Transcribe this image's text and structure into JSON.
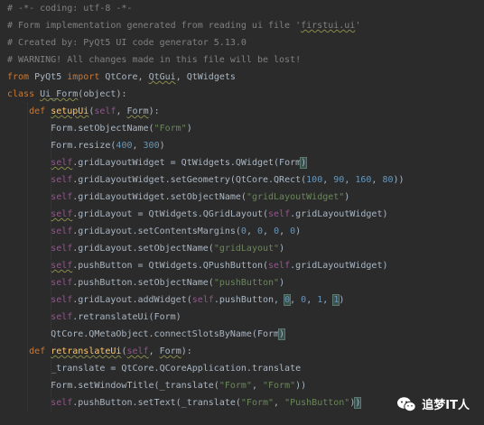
{
  "editor": {
    "language": "python",
    "lines": [
      [
        {
          "t": "# -*- coding: utf-8 -*-",
          "c": "cm"
        }
      ],
      [
        {
          "t": "# Form implementation generated from reading ui file '",
          "c": "cm"
        },
        {
          "t": "firstui.ui",
          "c": "cm wavy"
        },
        {
          "t": "'",
          "c": "cm"
        }
      ],
      [
        {
          "t": "# Created by: PyQt5 UI code generator 5.13.0",
          "c": "cm"
        }
      ],
      [
        {
          "t": "# WARNING! All changes made in this file will be lost!",
          "c": "cm"
        }
      ],
      [
        {
          "t": "from ",
          "c": "kw"
        },
        {
          "t": "PyQt5 ",
          "c": "cls"
        },
        {
          "t": "import ",
          "c": "kw"
        },
        {
          "t": "QtCore, ",
          "c": "cls"
        },
        {
          "t": "QtGui",
          "c": "cls wavy"
        },
        {
          "t": ", QtWidgets",
          "c": "cls"
        }
      ],
      [
        {
          "t": "class ",
          "c": "kw"
        },
        {
          "t": "Ui_Form",
          "c": "cls wavy"
        },
        {
          "t": "(",
          "c": "cls"
        },
        {
          "t": "object",
          "c": "cls"
        },
        {
          "t": "):",
          "c": "cls"
        }
      ],
      [
        {
          "t": "    ",
          "c": "cls"
        },
        {
          "t": "def ",
          "c": "kw"
        },
        {
          "t": "setupUi",
          "c": "fn wavy"
        },
        {
          "t": "(",
          "c": "cls"
        },
        {
          "t": "self",
          "c": "slf"
        },
        {
          "t": ", ",
          "c": "cls"
        },
        {
          "t": "Form",
          "c": "cls wavy"
        },
        {
          "t": "):",
          "c": "cls"
        }
      ],
      [
        {
          "t": "        Form.setObjectName(",
          "c": "cls"
        },
        {
          "t": "\"Form\"",
          "c": "str"
        },
        {
          "t": ")",
          "c": "cls"
        }
      ],
      [
        {
          "t": "        Form.resize(",
          "c": "cls"
        },
        {
          "t": "400",
          "c": "num"
        },
        {
          "t": ", ",
          "c": "cls"
        },
        {
          "t": "300",
          "c": "num"
        },
        {
          "t": ")",
          "c": "cls"
        }
      ],
      [
        {
          "t": "        ",
          "c": "cls"
        },
        {
          "t": "self",
          "c": "slf wavy"
        },
        {
          "t": ".gridLayoutWidget = QtWidgets.QWidget(Form",
          "c": "cls"
        },
        {
          "t": ")",
          "c": "cls hl"
        }
      ],
      [
        {
          "t": "        ",
          "c": "cls"
        },
        {
          "t": "self",
          "c": "slf"
        },
        {
          "t": ".gridLayoutWidget.setGeometry(QtCore.QRect(",
          "c": "cls"
        },
        {
          "t": "100",
          "c": "num"
        },
        {
          "t": ", ",
          "c": "cls"
        },
        {
          "t": "90",
          "c": "num"
        },
        {
          "t": ", ",
          "c": "cls"
        },
        {
          "t": "160",
          "c": "num"
        },
        {
          "t": ", ",
          "c": "cls"
        },
        {
          "t": "80",
          "c": "num"
        },
        {
          "t": "))",
          "c": "cls"
        }
      ],
      [
        {
          "t": "        ",
          "c": "cls"
        },
        {
          "t": "self",
          "c": "slf"
        },
        {
          "t": ".gridLayoutWidget.setObjectName(",
          "c": "cls"
        },
        {
          "t": "\"gridLayoutWidget\"",
          "c": "str"
        },
        {
          "t": ")",
          "c": "cls"
        }
      ],
      [
        {
          "t": "        ",
          "c": "cls"
        },
        {
          "t": "self",
          "c": "slf wavy"
        },
        {
          "t": ".gridLayout = QtWidgets.QGridLayout(",
          "c": "cls"
        },
        {
          "t": "self",
          "c": "slf"
        },
        {
          "t": ".gridLayoutWidget)",
          "c": "cls"
        }
      ],
      [
        {
          "t": "        ",
          "c": "cls"
        },
        {
          "t": "self",
          "c": "slf"
        },
        {
          "t": ".gridLayout.setContentsMargins(",
          "c": "cls"
        },
        {
          "t": "0",
          "c": "num"
        },
        {
          "t": ", ",
          "c": "cls"
        },
        {
          "t": "0",
          "c": "num"
        },
        {
          "t": ", ",
          "c": "cls"
        },
        {
          "t": "0",
          "c": "num"
        },
        {
          "t": ", ",
          "c": "cls"
        },
        {
          "t": "0",
          "c": "num"
        },
        {
          "t": ")",
          "c": "cls"
        }
      ],
      [
        {
          "t": "        ",
          "c": "cls"
        },
        {
          "t": "self",
          "c": "slf"
        },
        {
          "t": ".gridLayout.setObjectName(",
          "c": "cls"
        },
        {
          "t": "\"gridLayout\"",
          "c": "str"
        },
        {
          "t": ")",
          "c": "cls"
        }
      ],
      [
        {
          "t": "        ",
          "c": "cls"
        },
        {
          "t": "self",
          "c": "slf wavy"
        },
        {
          "t": ".pushButton = QtWidgets.QPushButton(",
          "c": "cls"
        },
        {
          "t": "self",
          "c": "slf"
        },
        {
          "t": ".gridLayoutWidget)",
          "c": "cls"
        }
      ],
      [
        {
          "t": "        ",
          "c": "cls"
        },
        {
          "t": "self",
          "c": "slf"
        },
        {
          "t": ".pushButton.setObjectName(",
          "c": "cls"
        },
        {
          "t": "\"pushButton\"",
          "c": "str"
        },
        {
          "t": ")",
          "c": "cls"
        }
      ],
      [
        {
          "t": "        ",
          "c": "cls"
        },
        {
          "t": "self",
          "c": "slf"
        },
        {
          "t": ".gridLayout.addWidget(",
          "c": "cls"
        },
        {
          "t": "self",
          "c": "slf"
        },
        {
          "t": ".pushButton, ",
          "c": "cls"
        },
        {
          "t": "0",
          "c": "num hl"
        },
        {
          "t": ", ",
          "c": "cls"
        },
        {
          "t": "0",
          "c": "num"
        },
        {
          "t": ", ",
          "c": "cls"
        },
        {
          "t": "1",
          "c": "num"
        },
        {
          "t": ", ",
          "c": "cls"
        },
        {
          "t": "1",
          "c": "num hl"
        },
        {
          "t": ")",
          "c": "cls"
        }
      ],
      [
        {
          "t": "        ",
          "c": "cls"
        },
        {
          "t": "self",
          "c": "slf"
        },
        {
          "t": ".retranslateUi(Form)",
          "c": "cls"
        }
      ],
      [
        {
          "t": "        QtCore.QMetaObject.connectSlotsByName(Form",
          "c": "cls"
        },
        {
          "t": ")",
          "c": "cls hl"
        }
      ],
      [
        {
          "t": "    ",
          "c": "cls"
        },
        {
          "t": "def ",
          "c": "kw"
        },
        {
          "t": "retranslateUi",
          "c": "fn wavy"
        },
        {
          "t": "(",
          "c": "cls"
        },
        {
          "t": "self",
          "c": "slf wavy"
        },
        {
          "t": ", ",
          "c": "cls"
        },
        {
          "t": "Form",
          "c": "cls wavy"
        },
        {
          "t": "):",
          "c": "cls"
        }
      ],
      [
        {
          "t": "        _translate = QtCore.QCoreApplication.translate",
          "c": "cls"
        }
      ],
      [
        {
          "t": "        Form.setWindowTitle(_translate(",
          "c": "cls"
        },
        {
          "t": "\"Form\"",
          "c": "str"
        },
        {
          "t": ", ",
          "c": "cls"
        },
        {
          "t": "\"Form\"",
          "c": "str"
        },
        {
          "t": "))",
          "c": "cls"
        }
      ],
      [
        {
          "t": "        ",
          "c": "cls"
        },
        {
          "t": "self",
          "c": "slf"
        },
        {
          "t": ".pushButton.setText(_translate(",
          "c": "cls"
        },
        {
          "t": "\"Form\"",
          "c": "str"
        },
        {
          "t": ", ",
          "c": "cls"
        },
        {
          "t": "\"PushButton\"",
          "c": "str"
        },
        {
          "t": ")",
          "c": "cls"
        },
        {
          "t": ")",
          "c": "cls hl"
        }
      ]
    ]
  },
  "watermark": {
    "text": "追梦IT人",
    "icon": "wechat-icon"
  },
  "colors": {
    "background": "#2b2b2b",
    "keyword": "#cc7832",
    "comment": "#808080",
    "string": "#6a8759",
    "number": "#6897bb",
    "function": "#ffc66d",
    "self": "#94558d",
    "text": "#a9b7c6"
  }
}
